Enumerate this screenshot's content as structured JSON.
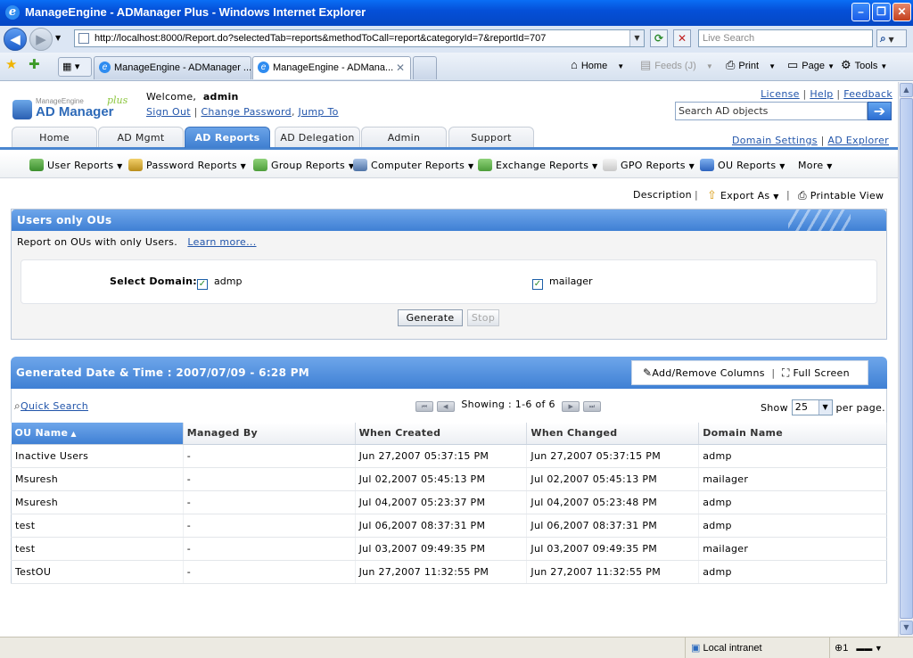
{
  "window": {
    "title": "ManageEngine - ADManager Plus - Windows Internet Explorer"
  },
  "browser": {
    "address": "http://localhost:8000/Report.do?selectedTab=reports&methodToCall=report&categoryId=7&reportId=707",
    "search_placeholder": "Live Search",
    "tabs": [
      {
        "label": "ManageEngine - ADManager ..."
      },
      {
        "label": "ManageEngine - ADMana..."
      }
    ],
    "commands": {
      "home": "Home",
      "feeds": "Feeds (J)",
      "print": "Print",
      "page": "Page",
      "tools": "Tools"
    },
    "status": {
      "zone": "Local intranet",
      "zoom": "1"
    }
  },
  "app": {
    "logo": {
      "top": "ManageEngine",
      "main": "AD Manager",
      "suffix": "plus"
    },
    "welcome": "Welcome,",
    "user": "admin",
    "user_links": [
      "Sign Out",
      "Change Password",
      "Jump To"
    ],
    "top_links": [
      "License",
      "Help",
      "Feedback"
    ],
    "search_value": "Search AD objects",
    "tabs": [
      "Home",
      "AD Mgmt",
      "AD Reports",
      "AD Delegation",
      "Admin",
      "Support"
    ],
    "active_tab": "AD Reports",
    "domain_links": [
      "Domain Settings",
      "AD Explorer"
    ],
    "subnav": [
      "User Reports",
      "Password Reports",
      "Group Reports",
      "Computer Reports",
      "Exchange Reports",
      "GPO Reports",
      "OU Reports",
      "More"
    ],
    "toolbar": {
      "description": "Description",
      "export": "Export As",
      "printable": "Printable View"
    }
  },
  "report": {
    "title": "Users only OUs",
    "description": "Report on OUs with only Users.",
    "learn_more": "Learn more...",
    "select_domain_label": "Select Domain:",
    "domains": [
      {
        "name": "admp",
        "checked": true
      },
      {
        "name": "mailager",
        "checked": true
      }
    ],
    "generate": "Generate",
    "stop": "Stop"
  },
  "results": {
    "generated": "Generated Date & Time : 2007/07/09 - 6:28 PM",
    "add_remove_columns": "Add/Remove Columns",
    "full_screen": "Full Screen",
    "quick_search": "Quick Search",
    "showing": "Showing : 1-6 of 6",
    "show_label": "Show",
    "page_size": "25",
    "per_page": "per page.",
    "columns": [
      "OU Name",
      "Managed By",
      "When Created",
      "When Changed",
      "Domain Name"
    ],
    "sort_column": "OU Name",
    "rows": [
      [
        "Inactive Users",
        "-",
        "Jun 27,2007 05:37:15 PM",
        "Jun 27,2007 05:37:15 PM",
        "admp"
      ],
      [
        "Msuresh",
        "-",
        "Jul 02,2007 05:45:13 PM",
        "Jul 02,2007 05:45:13 PM",
        "mailager"
      ],
      [
        "Msuresh",
        "-",
        "Jul 04,2007 05:23:37 PM",
        "Jul 04,2007 05:23:48 PM",
        "admp"
      ],
      [
        "test",
        "-",
        "Jul 06,2007 08:37:31 PM",
        "Jul 06,2007 08:37:31 PM",
        "admp"
      ],
      [
        "test",
        "-",
        "Jul 03,2007 09:49:35 PM",
        "Jul 03,2007 09:49:35 PM",
        "mailager"
      ],
      [
        "TestOU",
        "-",
        "Jun 27,2007 11:32:55 PM",
        "Jun 27,2007 11:32:55 PM",
        "admp"
      ]
    ]
  },
  "colors": {
    "accent": "#3f80d4",
    "link": "#2255aa",
    "title_bar": "#0550d8"
  }
}
